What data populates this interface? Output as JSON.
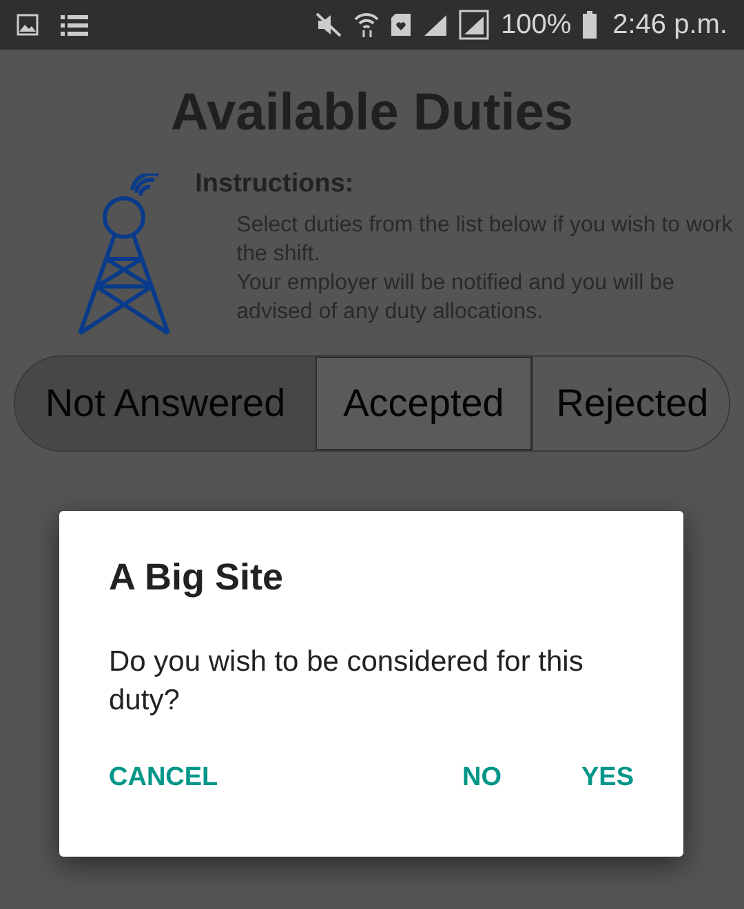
{
  "status_bar": {
    "battery": "100%",
    "time": "2:46 p.m."
  },
  "title": "Available Duties",
  "instructions": {
    "heading": "Instructions:",
    "lines": [
      "Select duties from the list below if you wish to work the shift.",
      "Your employer will be notified and you will be advised of any duty allocations."
    ]
  },
  "tabs": [
    {
      "label": "Not Answered",
      "selected": true
    },
    {
      "label": "Accepted",
      "selected": false
    },
    {
      "label": "Rejected",
      "selected": false
    }
  ],
  "dialog": {
    "title": "A Big Site",
    "message": "Do you wish to be considered for this duty?",
    "buttons": [
      "CANCEL",
      "NO",
      "YES"
    ]
  }
}
